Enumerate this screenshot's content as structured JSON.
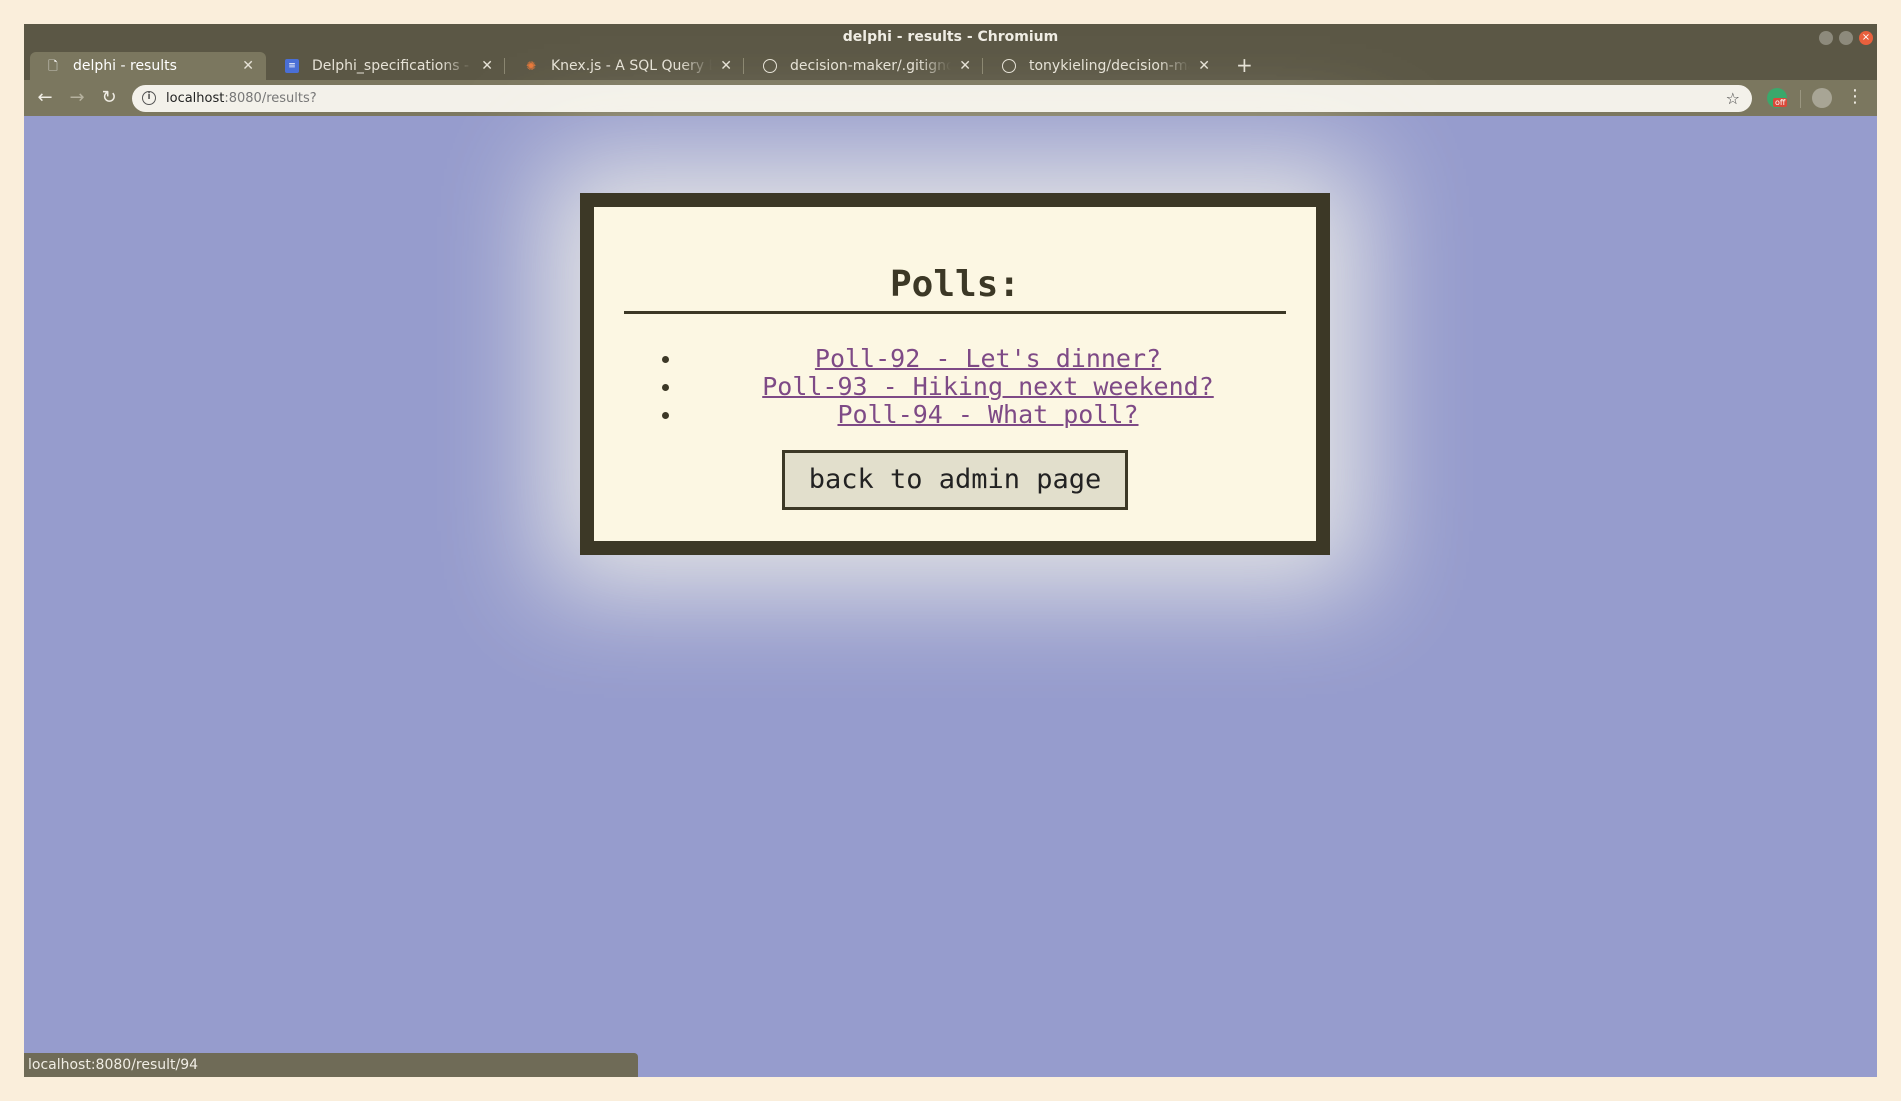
{
  "window": {
    "title": "delphi - results - Chromium"
  },
  "tabs": [
    {
      "label": "delphi - results",
      "icon": "page-icon",
      "active": true
    },
    {
      "label": "Delphi_specifications - Go",
      "icon": "docs-icon",
      "active": false
    },
    {
      "label": "Knex.js - A SQL Query Bui",
      "icon": "knex-icon",
      "active": false
    },
    {
      "label": "decision-maker/.gitignore",
      "icon": "github-icon",
      "active": false
    },
    {
      "label": "tonykieling/decision-mak",
      "icon": "github-icon",
      "active": false
    }
  ],
  "toolbar": {
    "url_host": "localhost",
    "url_path": ":8080/results?",
    "ext_badge": "off"
  },
  "page": {
    "heading": "Polls:",
    "polls": [
      {
        "label": "Poll-92 - Let's dinner?"
      },
      {
        "label": "Poll-93 - Hiking next weekend?"
      },
      {
        "label": "Poll-94 - What poll?"
      }
    ],
    "back_button": "back to admin page"
  },
  "status_bar": {
    "text": "localhost:8080/result/94"
  },
  "colors": {
    "page_background": "#969ccd",
    "card_border": "#3c3826",
    "card_background": "#fcf7e3",
    "link": "#7e4a86",
    "button_background": "#e2dfcc"
  }
}
